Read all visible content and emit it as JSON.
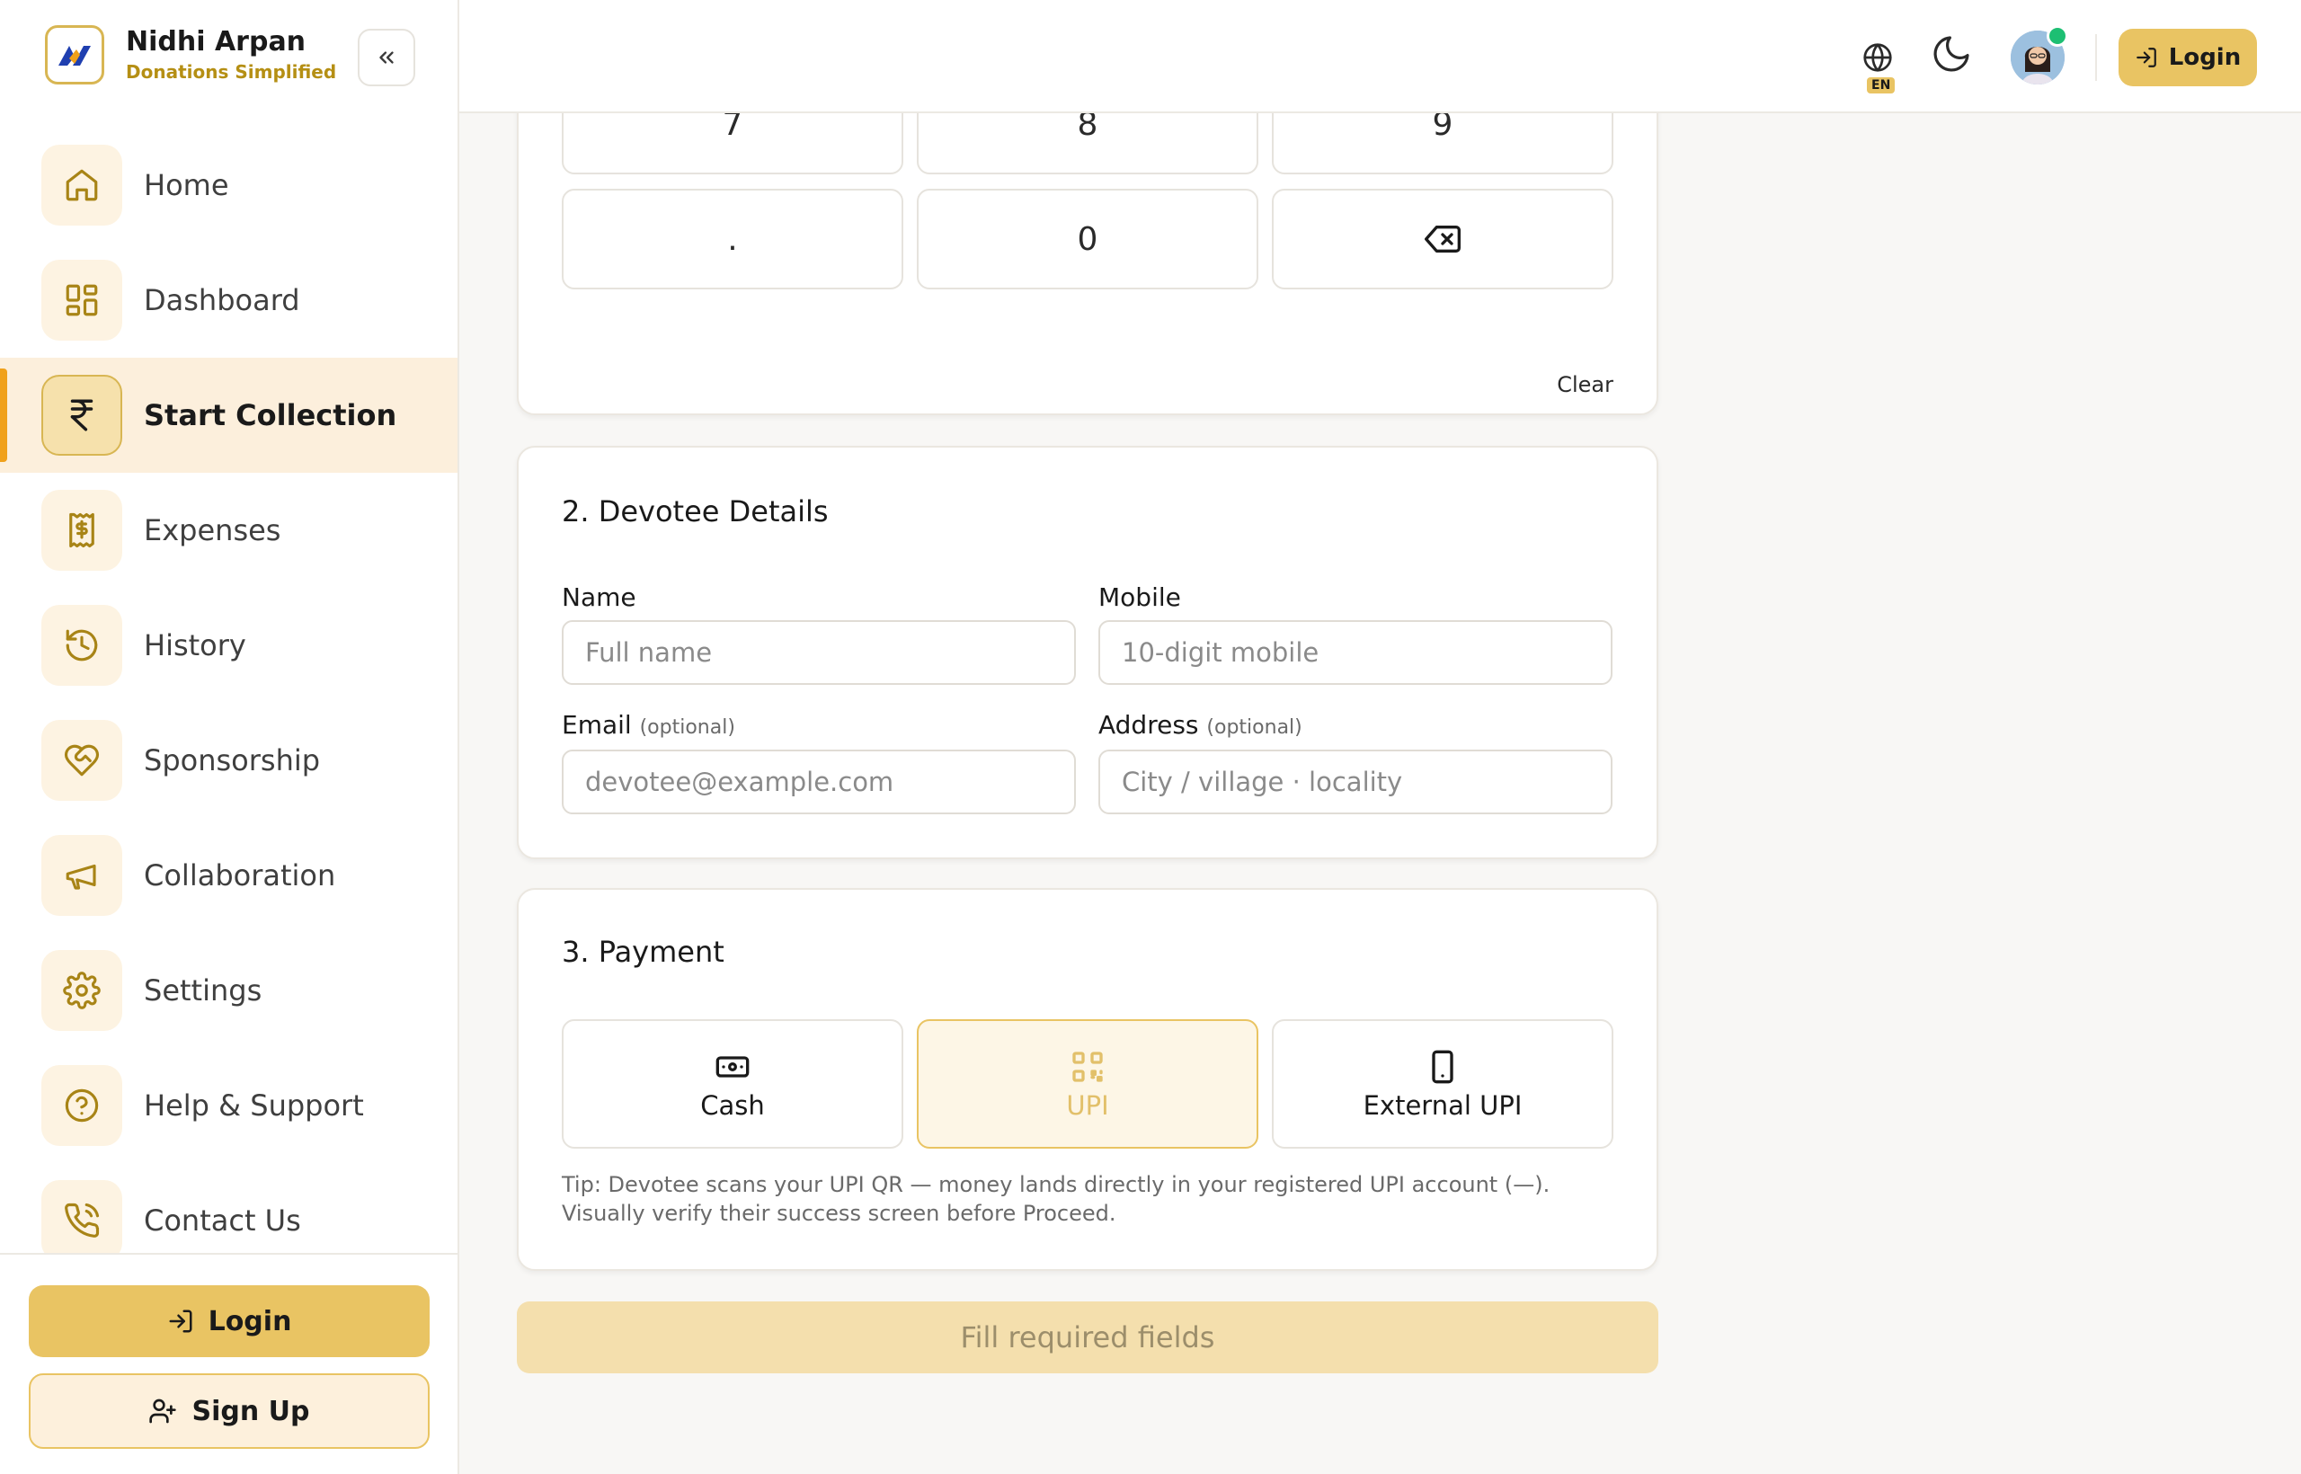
{
  "brand": {
    "name": "Nidhi Arpan",
    "tagline": "Donations Simplified"
  },
  "sidebar": {
    "items": [
      {
        "label": "Home",
        "icon": "home-icon",
        "active": false
      },
      {
        "label": "Dashboard",
        "icon": "dashboard-icon",
        "active": false
      },
      {
        "label": "Start Collection",
        "icon": "rupee-icon",
        "active": true
      },
      {
        "label": "Expenses",
        "icon": "receipt-icon",
        "active": false
      },
      {
        "label": "History",
        "icon": "history-icon",
        "active": false
      },
      {
        "label": "Sponsorship",
        "icon": "heart-handshake-icon",
        "active": false
      },
      {
        "label": "Collaboration",
        "icon": "megaphone-icon",
        "active": false
      },
      {
        "label": "Settings",
        "icon": "gear-icon",
        "active": false
      },
      {
        "label": "Help & Support",
        "icon": "help-icon",
        "active": false
      },
      {
        "label": "Contact Us",
        "icon": "phone-icon",
        "active": false
      }
    ],
    "login_label": "Login",
    "signup_label": "Sign Up"
  },
  "topbar": {
    "language_badge": "EN",
    "login_label": "Login"
  },
  "keypad": {
    "keys": [
      "7",
      "8",
      "9",
      ".",
      "0",
      ""
    ],
    "clear_label": "Clear"
  },
  "devotee": {
    "title": "2. Devotee Details",
    "name_label": "Name",
    "name_placeholder": "Full name",
    "mobile_label": "Mobile",
    "mobile_placeholder": "10-digit mobile",
    "email_label": "Email",
    "email_optional": "(optional)",
    "email_placeholder": "devotee@example.com",
    "address_label": "Address",
    "address_optional": "(optional)",
    "address_placeholder": "City / village · locality"
  },
  "payment": {
    "title": "3. Payment",
    "options": [
      {
        "label": "Cash",
        "icon": "cash-icon",
        "selected": false
      },
      {
        "label": "UPI",
        "icon": "qr-code-icon",
        "selected": true
      },
      {
        "label": "External UPI",
        "icon": "phone-device-icon",
        "selected": false
      }
    ],
    "tip": "Tip: Devotee scans your UPI QR — money lands directly in your registered UPI account (—). Visually verify their success screen before Proceed."
  },
  "submit_label": "Fill required fields",
  "colors": {
    "accent": "#e9c463",
    "accent_dark": "#b58f14",
    "active_bg": "#fcefdc",
    "active_bar": "#f0a11b"
  }
}
